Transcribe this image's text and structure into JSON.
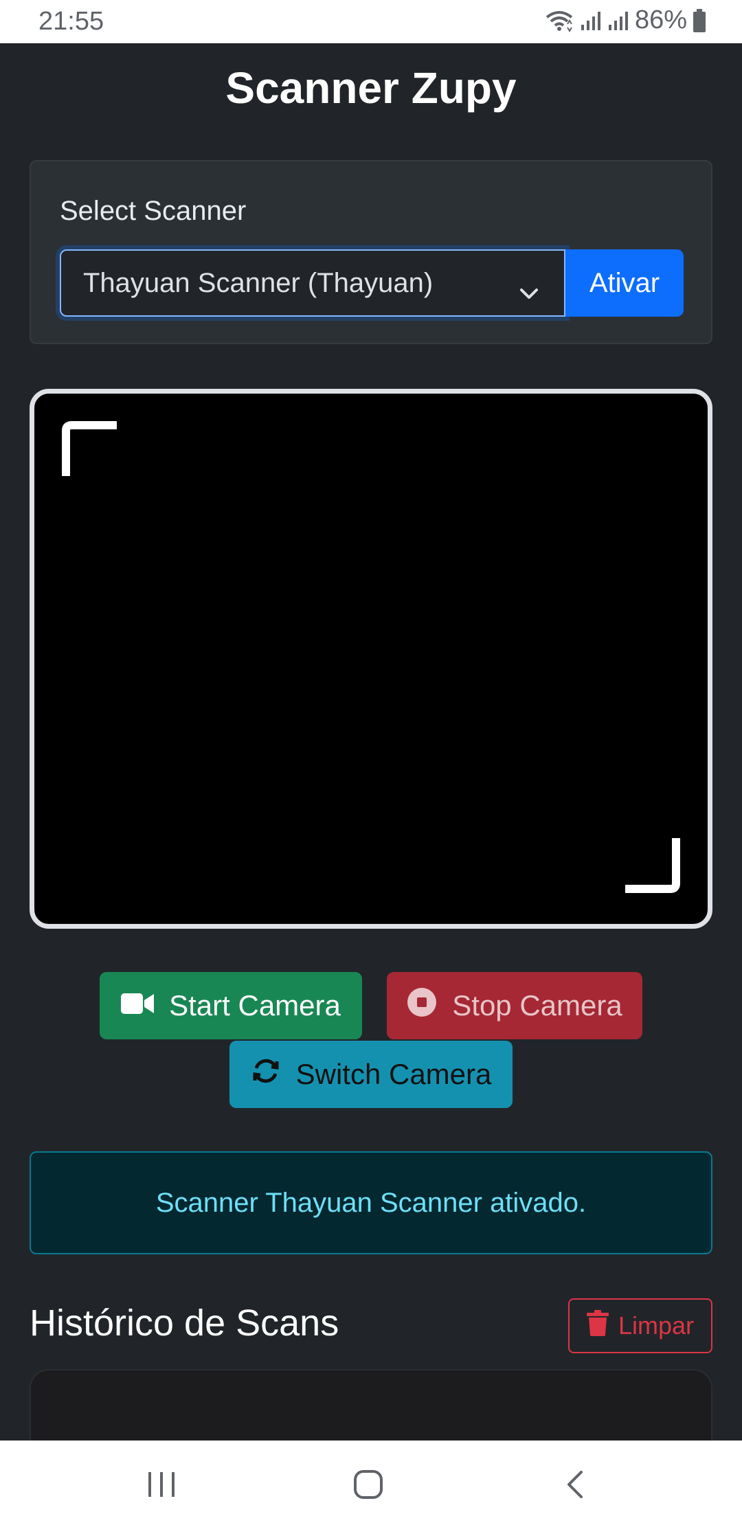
{
  "status_bar": {
    "time": "21:55",
    "battery": "86%",
    "icons": [
      "wifi-icon",
      "signal-icon",
      "signal-icon",
      "battery-icon"
    ]
  },
  "app": {
    "title": "Scanner Zupy"
  },
  "scanner_select": {
    "label": "Select Scanner",
    "selected": "Thayuan Scanner (Thayuan)",
    "activate_label": "Ativar"
  },
  "camera_controls": {
    "start_label": "Start Camera",
    "stop_label": "Stop Camera",
    "switch_label": "Switch Camera"
  },
  "alert": {
    "message": "Scanner Thayuan Scanner ativado."
  },
  "history": {
    "title": "Histórico de Scans",
    "clear_label": "Limpar"
  },
  "colors": {
    "primary": "#0d6efd",
    "success": "#198754",
    "danger": "#dc3545",
    "info": "#0dcaf0",
    "background": "#212529"
  }
}
